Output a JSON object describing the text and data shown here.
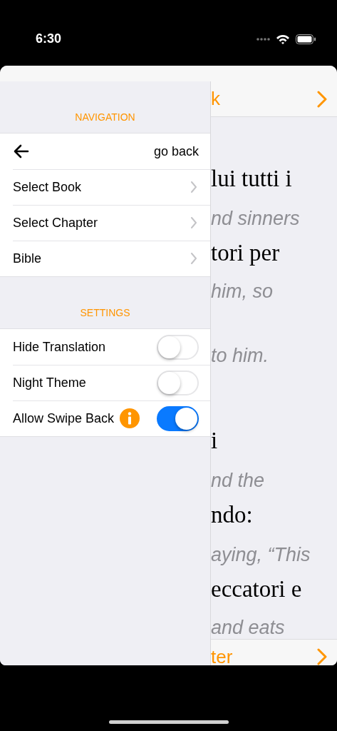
{
  "status_bar": {
    "time": "6:30"
  },
  "drawer": {
    "sections": [
      {
        "header": "NAVIGATION",
        "items": [
          {
            "kind": "back",
            "label": "go back"
          },
          {
            "kind": "link",
            "label": "Select Book"
          },
          {
            "kind": "link",
            "label": "Select Chapter"
          },
          {
            "kind": "link",
            "label": "Bible"
          }
        ]
      },
      {
        "header": "SETTINGS",
        "items": [
          {
            "kind": "toggle",
            "label": "Hide Translation",
            "on": false
          },
          {
            "kind": "toggle",
            "label": "Night Theme",
            "on": false
          },
          {
            "kind": "toggle",
            "label": "Allow Swipe Back",
            "on": true,
            "info": true
          }
        ]
      }
    ]
  },
  "reader": {
    "top_bar": {
      "title": "k"
    },
    "lines": [
      {
        "kind": "original",
        "text": "lui tutti i"
      },
      {
        "kind": "translation",
        "text": "nd sinners"
      },
      {
        "kind": "original",
        "text": "tori per"
      },
      {
        "kind": "translation",
        "text": "him, so"
      },
      {
        "kind": "translation",
        "text": "to him."
      },
      {
        "kind": "original",
        "text": "i"
      },
      {
        "kind": "translation",
        "text": "nd the"
      },
      {
        "kind": "original",
        "text": "ndo:"
      },
      {
        "kind": "translation",
        "text": "aying, “This"
      },
      {
        "kind": "original",
        "text": "eccatori e"
      },
      {
        "kind": "translation",
        "text": "and eats"
      }
    ],
    "bottom_bar": {
      "title": "ter"
    }
  }
}
